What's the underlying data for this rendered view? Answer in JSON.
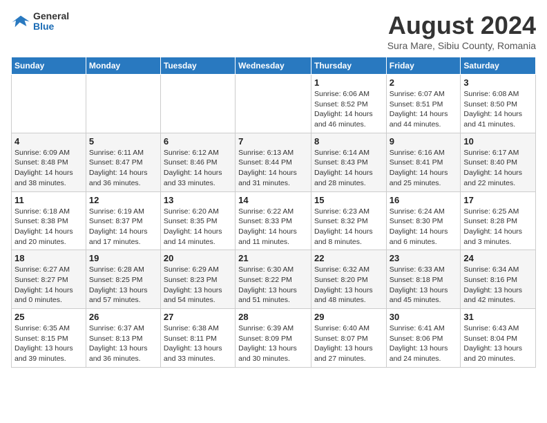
{
  "logo": {
    "line1": "General",
    "line2": "Blue"
  },
  "title": "August 2024",
  "subtitle": "Sura Mare, Sibiu County, Romania",
  "headers": [
    "Sunday",
    "Monday",
    "Tuesday",
    "Wednesday",
    "Thursday",
    "Friday",
    "Saturday"
  ],
  "weeks": [
    [
      {
        "day": "",
        "info": ""
      },
      {
        "day": "",
        "info": ""
      },
      {
        "day": "",
        "info": ""
      },
      {
        "day": "",
        "info": ""
      },
      {
        "day": "1",
        "info": "Sunrise: 6:06 AM\nSunset: 8:52 PM\nDaylight: 14 hours and 46 minutes."
      },
      {
        "day": "2",
        "info": "Sunrise: 6:07 AM\nSunset: 8:51 PM\nDaylight: 14 hours and 44 minutes."
      },
      {
        "day": "3",
        "info": "Sunrise: 6:08 AM\nSunset: 8:50 PM\nDaylight: 14 hours and 41 minutes."
      }
    ],
    [
      {
        "day": "4",
        "info": "Sunrise: 6:09 AM\nSunset: 8:48 PM\nDaylight: 14 hours and 38 minutes."
      },
      {
        "day": "5",
        "info": "Sunrise: 6:11 AM\nSunset: 8:47 PM\nDaylight: 14 hours and 36 minutes."
      },
      {
        "day": "6",
        "info": "Sunrise: 6:12 AM\nSunset: 8:46 PM\nDaylight: 14 hours and 33 minutes."
      },
      {
        "day": "7",
        "info": "Sunrise: 6:13 AM\nSunset: 8:44 PM\nDaylight: 14 hours and 31 minutes."
      },
      {
        "day": "8",
        "info": "Sunrise: 6:14 AM\nSunset: 8:43 PM\nDaylight: 14 hours and 28 minutes."
      },
      {
        "day": "9",
        "info": "Sunrise: 6:16 AM\nSunset: 8:41 PM\nDaylight: 14 hours and 25 minutes."
      },
      {
        "day": "10",
        "info": "Sunrise: 6:17 AM\nSunset: 8:40 PM\nDaylight: 14 hours and 22 minutes."
      }
    ],
    [
      {
        "day": "11",
        "info": "Sunrise: 6:18 AM\nSunset: 8:38 PM\nDaylight: 14 hours and 20 minutes."
      },
      {
        "day": "12",
        "info": "Sunrise: 6:19 AM\nSunset: 8:37 PM\nDaylight: 14 hours and 17 minutes."
      },
      {
        "day": "13",
        "info": "Sunrise: 6:20 AM\nSunset: 8:35 PM\nDaylight: 14 hours and 14 minutes."
      },
      {
        "day": "14",
        "info": "Sunrise: 6:22 AM\nSunset: 8:33 PM\nDaylight: 14 hours and 11 minutes."
      },
      {
        "day": "15",
        "info": "Sunrise: 6:23 AM\nSunset: 8:32 PM\nDaylight: 14 hours and 8 minutes."
      },
      {
        "day": "16",
        "info": "Sunrise: 6:24 AM\nSunset: 8:30 PM\nDaylight: 14 hours and 6 minutes."
      },
      {
        "day": "17",
        "info": "Sunrise: 6:25 AM\nSunset: 8:28 PM\nDaylight: 14 hours and 3 minutes."
      }
    ],
    [
      {
        "day": "18",
        "info": "Sunrise: 6:27 AM\nSunset: 8:27 PM\nDaylight: 14 hours and 0 minutes."
      },
      {
        "day": "19",
        "info": "Sunrise: 6:28 AM\nSunset: 8:25 PM\nDaylight: 13 hours and 57 minutes."
      },
      {
        "day": "20",
        "info": "Sunrise: 6:29 AM\nSunset: 8:23 PM\nDaylight: 13 hours and 54 minutes."
      },
      {
        "day": "21",
        "info": "Sunrise: 6:30 AM\nSunset: 8:22 PM\nDaylight: 13 hours and 51 minutes."
      },
      {
        "day": "22",
        "info": "Sunrise: 6:32 AM\nSunset: 8:20 PM\nDaylight: 13 hours and 48 minutes."
      },
      {
        "day": "23",
        "info": "Sunrise: 6:33 AM\nSunset: 8:18 PM\nDaylight: 13 hours and 45 minutes."
      },
      {
        "day": "24",
        "info": "Sunrise: 6:34 AM\nSunset: 8:16 PM\nDaylight: 13 hours and 42 minutes."
      }
    ],
    [
      {
        "day": "25",
        "info": "Sunrise: 6:35 AM\nSunset: 8:15 PM\nDaylight: 13 hours and 39 minutes."
      },
      {
        "day": "26",
        "info": "Sunrise: 6:37 AM\nSunset: 8:13 PM\nDaylight: 13 hours and 36 minutes."
      },
      {
        "day": "27",
        "info": "Sunrise: 6:38 AM\nSunset: 8:11 PM\nDaylight: 13 hours and 33 minutes."
      },
      {
        "day": "28",
        "info": "Sunrise: 6:39 AM\nSunset: 8:09 PM\nDaylight: 13 hours and 30 minutes."
      },
      {
        "day": "29",
        "info": "Sunrise: 6:40 AM\nSunset: 8:07 PM\nDaylight: 13 hours and 27 minutes."
      },
      {
        "day": "30",
        "info": "Sunrise: 6:41 AM\nSunset: 8:06 PM\nDaylight: 13 hours and 24 minutes."
      },
      {
        "day": "31",
        "info": "Sunrise: 6:43 AM\nSunset: 8:04 PM\nDaylight: 13 hours and 20 minutes."
      }
    ]
  ]
}
